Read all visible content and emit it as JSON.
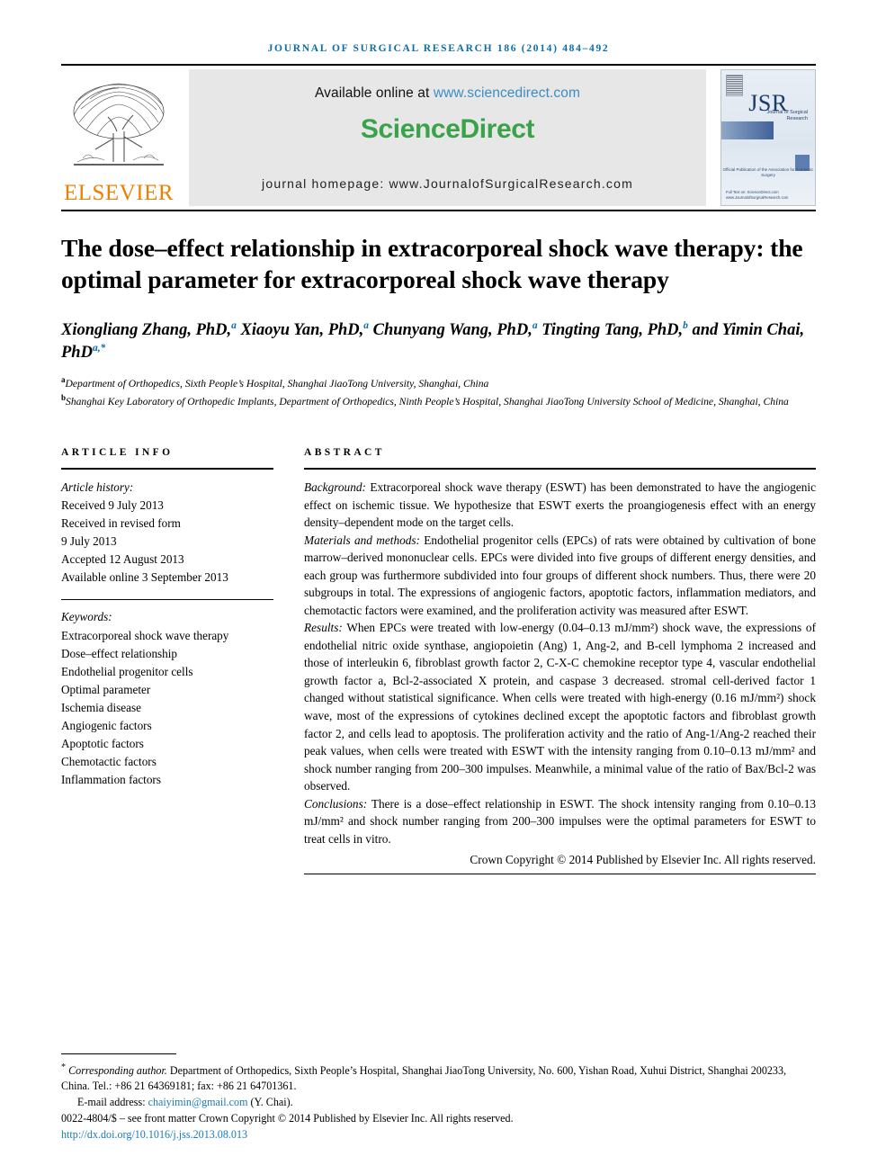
{
  "running_head": "JOURNAL OF SURGICAL RESEARCH 186 (2014) 484–492",
  "masthead": {
    "publisher_logo_text": "ELSEVIER",
    "publisher_logo_icon": "elsevier-tree-icon",
    "available_prefix": "Available online at ",
    "available_url": "www.sciencedirect.com",
    "sciencedirect_wordmark": "ScienceDirect",
    "journal_homepage": "journal homepage: www.JournalofSurgicalResearch.com",
    "cover": {
      "title": "JSR",
      "subtitle": "Journal of\nSurgical Research",
      "note": "Official Publication of the\nAssociation for Academic Surgery",
      "foot": "Full Text on: ScienceDirect.com\nwww.JournalofSurgicalResearch.com"
    },
    "colors": {
      "running_head": "#0b6ea8",
      "elsevier_orange": "#ee7f00",
      "sciencedirect_green": "#3aa34a",
      "link_blue": "#3c8dc5",
      "banner_gray": "#e7e7e7"
    }
  },
  "article": {
    "title": "The dose–effect relationship in extracorporeal shock wave therapy: the optimal parameter for extracorporeal shock wave therapy",
    "authors": [
      {
        "name": "Xiongliang Zhang, PhD,",
        "marker": "a"
      },
      {
        "name": "Xiaoyu Yan, PhD,",
        "marker": "a"
      },
      {
        "name": "Chunyang Wang, PhD,",
        "marker": "a"
      },
      {
        "name": "Tingting Tang, PhD,",
        "marker": "b"
      },
      {
        "name": "and Yimin Chai, PhD",
        "marker": "a,*"
      }
    ],
    "affiliations": [
      {
        "marker": "a",
        "text": "Department of Orthopedics, Sixth People’s Hospital, Shanghai JiaoTong University, Shanghai, China"
      },
      {
        "marker": "b",
        "text": "Shanghai Key Laboratory of Orthopedic Implants, Department of Orthopedics, Ninth People’s Hospital, Shanghai JiaoTong University School of Medicine, Shanghai, China"
      }
    ]
  },
  "article_info": {
    "heading": "ARTICLE INFO",
    "history_label": "Article history:",
    "history": [
      "Received 9 July 2013",
      "Received in revised form",
      "9 July 2013",
      "Accepted 12 August 2013",
      "Available online 3 September 2013"
    ],
    "keywords_label": "Keywords:",
    "keywords": [
      "Extracorporeal shock wave therapy",
      "Dose–effect relationship",
      "Endothelial progenitor cells",
      "Optimal parameter",
      "Ischemia disease",
      "Angiogenic factors",
      "Apoptotic factors",
      "Chemotactic factors",
      "Inflammation factors"
    ]
  },
  "abstract": {
    "heading": "ABSTRACT",
    "sections": [
      {
        "label": "Background:",
        "body": " Extracorporeal shock wave therapy (ESWT) has been demonstrated to have the angiogenic effect on ischemic tissue. We hypothesize that ESWT exerts the proangiogenesis effect with an energy density–dependent mode on the target cells."
      },
      {
        "label": "Materials and methods:",
        "body": " Endothelial progenitor cells (EPCs) of rats were obtained by cultivation of bone marrow–derived mononuclear cells. EPCs were divided into five groups of different energy densities, and each group was furthermore subdivided into four groups of different shock numbers. Thus, there were 20 subgroups in total. The expressions of angiogenic factors, apoptotic factors, inflammation mediators, and chemotactic factors were examined, and the proliferation activity was measured after ESWT."
      },
      {
        "label": "Results:",
        "body": " When EPCs were treated with low-energy (0.04–0.13 mJ/mm²) shock wave, the expressions of endothelial nitric oxide synthase, angiopoietin (Ang) 1, Ang-2, and B-cell lymphoma 2 increased and those of interleukin 6, fibroblast growth factor 2, C-X-C chemokine receptor type 4, vascular endothelial growth factor a, Bcl-2-associated X protein, and caspase 3 decreased. stromal cell-derived factor 1 changed without statistical significance. When cells were treated with high-energy (0.16 mJ/mm²) shock wave, most of the expressions of cytokines declined except the apoptotic factors and fibroblast growth factor 2, and cells lead to apoptosis. The proliferation activity and the ratio of Ang-1/Ang-2 reached their peak values, when cells were treated with ESWT with the intensity ranging from 0.10–0.13 mJ/mm² and shock number ranging from 200–300 impulses. Meanwhile, a minimal value of the ratio of Bax/Bcl-2 was observed."
      },
      {
        "label": "Conclusions:",
        "body": " There is a dose–effect relationship in ESWT. The shock intensity ranging from 0.10–0.13 mJ/mm² and shock number ranging from 200–300 impulses were the optimal parameters for ESWT to treat cells in vitro."
      }
    ],
    "copyright": "Crown Copyright © 2014 Published by Elsevier Inc. All rights reserved."
  },
  "footnotes": {
    "corresponding_marker": "*",
    "corresponding_label": "Corresponding author.",
    "corresponding_text": " Department of Orthopedics, Sixth People’s Hospital, Shanghai JiaoTong University, No. 600, Yishan Road, Xuhui District, Shanghai 200233, China. Tel.: +86 21 64369181; fax: +86 21 64701361.",
    "email_label": "E-mail address:",
    "email": "chaiyimin@gmail.com",
    "email_suffix": " (Y. Chai).",
    "issn_line": "0022-4804/$ – see front matter Crown Copyright © 2014 Published by Elsevier Inc. All rights reserved.",
    "doi": "http://dx.doi.org/10.1016/j.jss.2013.08.013"
  }
}
